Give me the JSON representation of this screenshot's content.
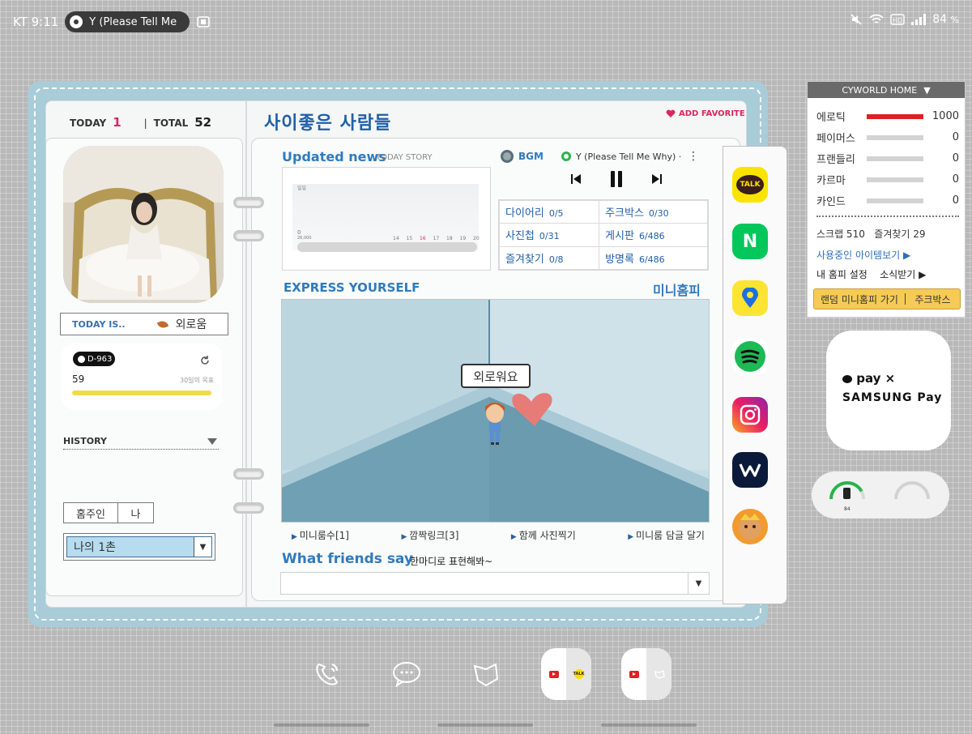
{
  "status_bar": {
    "carrier_time": "KT 9:11",
    "now_playing": "Y (Please Tell Me",
    "battery": "84",
    "battery_unit": "%"
  },
  "left_page": {
    "today_label": "TODAY",
    "today_value": "1",
    "total_label": "TOTAL",
    "total_value": "52",
    "today_is_label": "TODAY IS..",
    "mood": "외로움",
    "dday_badge": "D-963",
    "dday_count": "59",
    "dday_goal": "30일의 목표",
    "history_label": "HISTORY",
    "tab_owner": "홈주인",
    "tab_me": "나",
    "ilchon_value": "나의 1촌"
  },
  "right_page": {
    "title": "사이좋은 사람들",
    "add_favorite": "ADD FAVORITE",
    "updated_news": "Updated news",
    "updated_sub": "TODAY STORY",
    "chart_axis": [
      "14",
      "15",
      "16",
      "17",
      "18",
      "19",
      "20"
    ],
    "chart_top_label": "일일",
    "chart_zero": "0",
    "chart_zero_sub": "26,000",
    "bgm_label": "BGM",
    "song_title": "Y (Please Tell Me Why) ···",
    "counts": [
      {
        "label": "다이어리",
        "value": "0/5"
      },
      {
        "label": "주크박스",
        "value": "0/30"
      },
      {
        "label": "사진첩",
        "value": "0/31"
      },
      {
        "label": "게시판",
        "value": "6/486"
      },
      {
        "label": "즐겨찾기",
        "value": "0/8"
      },
      {
        "label": "방명록",
        "value": "6/486"
      }
    ],
    "express_label": "EXPRESS YOURSELF",
    "minihompi_label": "미니홈피",
    "speech": "외로워요",
    "room_links": [
      "미니룸수[1]",
      "깜짝링크[3]",
      "함께 사진찍기",
      "미니룸 담글 달기"
    ],
    "friends_label": "What friends say",
    "friends_sub": "한마디로 표현해봐~"
  },
  "apps": {
    "talk": "TALK",
    "naver": "N"
  },
  "cyworld_panel": {
    "header": "CYWORLD HOME",
    "stats": [
      {
        "name": "에로틱",
        "value": "1000",
        "fill": 1.0
      },
      {
        "name": "페이머스",
        "value": "0",
        "fill": 0
      },
      {
        "name": "프랜들리",
        "value": "0",
        "fill": 0
      },
      {
        "name": "카르마",
        "value": "0",
        "fill": 0
      },
      {
        "name": "카인드",
        "value": "0",
        "fill": 0
      }
    ],
    "scrap": "스크랩 510",
    "favorites": "즐겨찾기 29",
    "items_link": "사용중인 아이템보기 ▶",
    "settings": "내 홈피 설정",
    "news": "소식받기 ▶",
    "random_btn": "랜덤 미니홈피 가기",
    "jukebox_btn": "주크박스"
  },
  "pay_widget": {
    "line1": "pay ×",
    "line2": "SAMSUNG Pay"
  },
  "battery_widget": {
    "value": "84",
    "level": 0.84
  },
  "colors": {
    "accent_blue": "#2f7bbd",
    "favorite_pink": "#e0245e",
    "notebook_blue": "#a8ccd8",
    "stat_red": "#e02020"
  }
}
